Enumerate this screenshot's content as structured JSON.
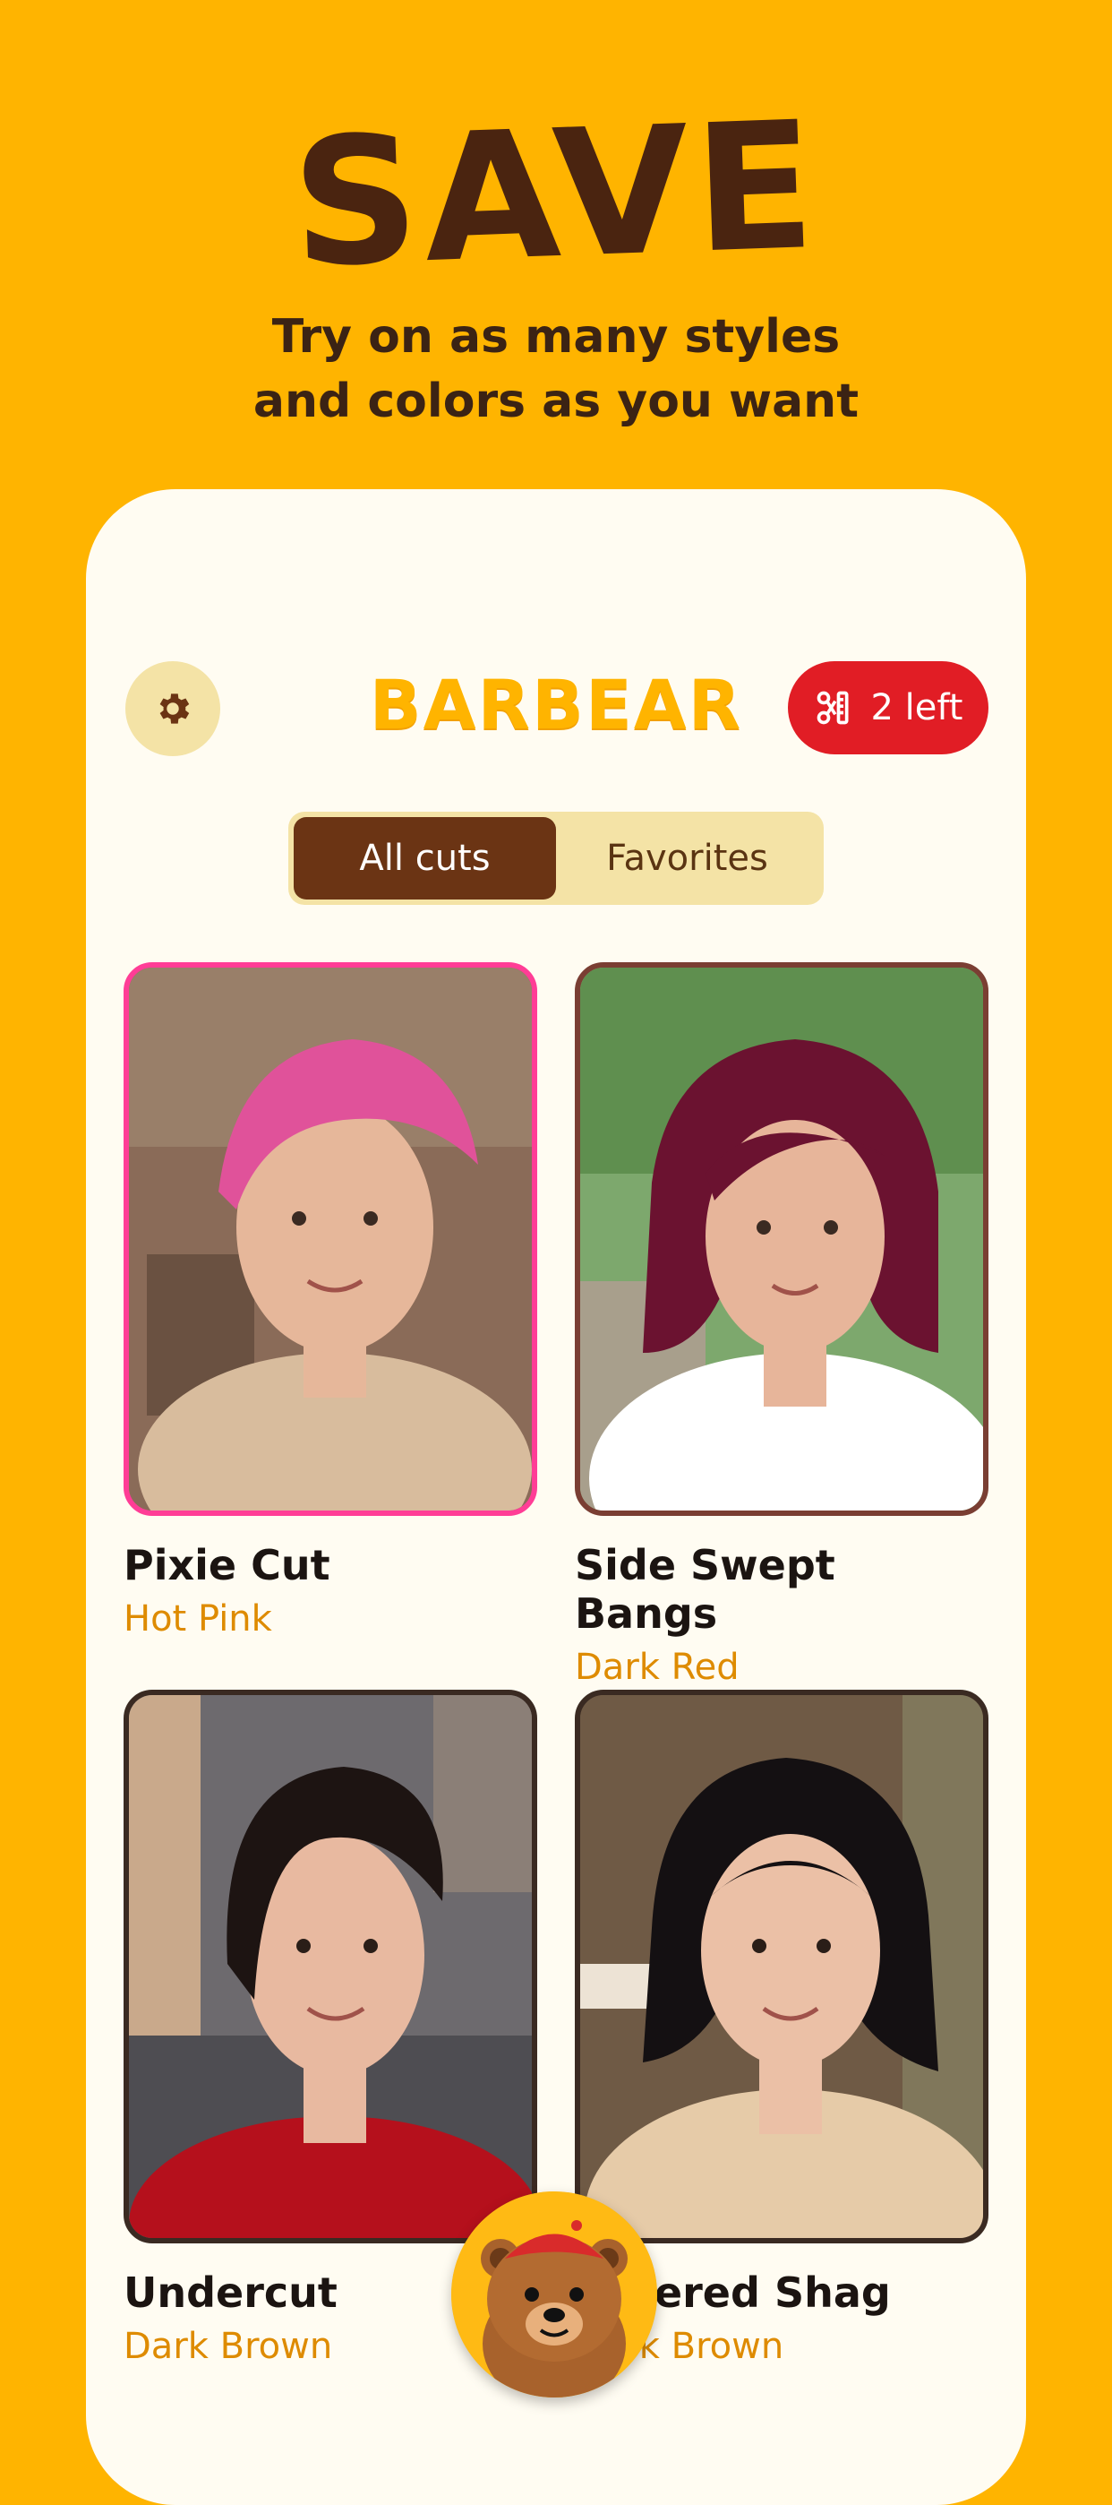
{
  "hero": {
    "title": "SAVE",
    "subtitle_line1": "Try on as many styles",
    "subtitle_line2": "and colors as you want"
  },
  "app": {
    "logo": "BARBEAR",
    "credits_label": "2 left",
    "tabs": [
      {
        "label": "All cuts",
        "active": true
      },
      {
        "label": "Favorites",
        "active": false
      }
    ]
  },
  "styles": [
    {
      "name": "Pixie Cut",
      "color": "Hot Pink",
      "hair": "#E0529A",
      "border": "#FF3D96",
      "bg": "#8A6B58",
      "skin": "#E6B79A",
      "shirt": "#D8BC9D"
    },
    {
      "name": "Side Swept Bangs",
      "color": "Dark Red",
      "hair": "#6B1230",
      "border": "#7A3E33",
      "bg": "#7DA86D",
      "skin": "#E7B59A",
      "shirt": "#FFFFFF"
    },
    {
      "name": "Undercut",
      "color": "Dark Brown",
      "hair": "#1D1412",
      "border": "#3A2A22",
      "bg": "#6D6A6E",
      "skin": "#E8B9A0",
      "shirt": "#B5101C"
    },
    {
      "name": "Layered Shag",
      "color": "Dark Brown",
      "hair": "#141012",
      "border": "#3A2A22",
      "bg": "#6F5A45",
      "skin": "#EBC0A6",
      "shirt": "#E6CBA8"
    }
  ]
}
